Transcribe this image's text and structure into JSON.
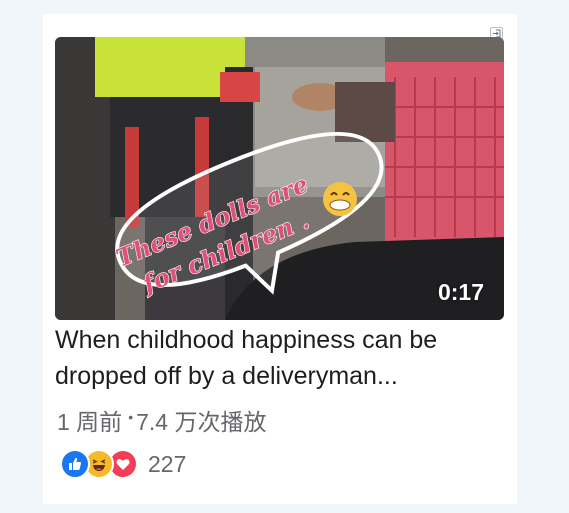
{
  "video": {
    "overlay_text": "These dolls are for children .",
    "duration": "0:17",
    "title": "When childhood happiness can be dropped off by a deliveryman...",
    "time_ago": "1 周前",
    "views": "7.4 万次播放"
  },
  "reactions": {
    "icons": [
      "like-icon",
      "haha-icon",
      "love-icon"
    ],
    "count": "227"
  },
  "colors": {
    "like": "#1877f2",
    "haha": "#f7b928",
    "love": "#f33e58",
    "title_text": "#1c1e21",
    "meta_text": "#65676b"
  }
}
